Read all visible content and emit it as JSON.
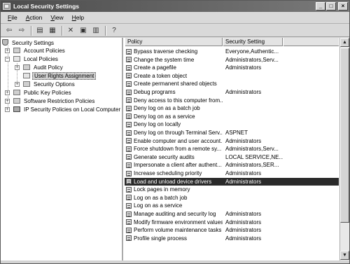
{
  "window": {
    "title": "Local Security Settings"
  },
  "menu": [
    "File",
    "Action",
    "View",
    "Help"
  ],
  "menu_mnemonic": [
    "F",
    "A",
    "V",
    "H"
  ],
  "toolbar_icons": [
    "back-arrow-icon",
    "forward-arrow-icon",
    "up-folder-icon",
    "show-hide-tree-icon",
    "delete-icon",
    "properties-icon",
    "export-list-icon",
    "help-icon"
  ],
  "tree": {
    "root": "Security Settings",
    "nodes": [
      {
        "label": "Account Policies"
      },
      {
        "label": "Local Policies"
      },
      {
        "label": "Audit Policy"
      },
      {
        "label": "User Rights Assignment"
      },
      {
        "label": "Security Options"
      },
      {
        "label": "Public Key Policies"
      },
      {
        "label": "Software Restriction Policies"
      },
      {
        "label": "IP Security Policies on Local Computer"
      }
    ]
  },
  "list": {
    "columns": [
      "Policy",
      "Security Setting"
    ],
    "rows": [
      {
        "policy": "Bypass traverse checking",
        "setting": "Everyone,Authentic..."
      },
      {
        "policy": "Change the system time",
        "setting": "Administrators,Serv..."
      },
      {
        "policy": "Create a pagefile",
        "setting": "Administrators"
      },
      {
        "policy": "Create a token object",
        "setting": ""
      },
      {
        "policy": "Create permanent shared objects",
        "setting": ""
      },
      {
        "policy": "Debug programs",
        "setting": "Administrators"
      },
      {
        "policy": "Deny access to this computer from...",
        "setting": ""
      },
      {
        "policy": "Deny log on as a batch job",
        "setting": ""
      },
      {
        "policy": "Deny log on as a service",
        "setting": ""
      },
      {
        "policy": "Deny log on locally",
        "setting": ""
      },
      {
        "policy": "Deny log on through Terminal Serv...",
        "setting": "ASPNET"
      },
      {
        "policy": "Enable computer and user account...",
        "setting": "Administrators"
      },
      {
        "policy": "Force shutdown from a remote sy...",
        "setting": "Administrators,Serv..."
      },
      {
        "policy": "Generate security audits",
        "setting": "LOCAL SERVICE,NE..."
      },
      {
        "policy": "Impersonate a client after authent...",
        "setting": "Administrators,SER..."
      },
      {
        "policy": "Increase scheduling priority",
        "setting": "Administrators"
      },
      {
        "policy": "Load and unload device drivers",
        "setting": "Administrators"
      },
      {
        "policy": "Lock pages in memory",
        "setting": ""
      },
      {
        "policy": "Log on as a batch job",
        "setting": ""
      },
      {
        "policy": "Log on as a service",
        "setting": ""
      },
      {
        "policy": "Manage auditing and security log",
        "setting": "Administrators"
      },
      {
        "policy": "Modify firmware environment values",
        "setting": "Administrators"
      },
      {
        "policy": "Perform volume maintenance tasks",
        "setting": "Administrators"
      },
      {
        "policy": "Profile single process",
        "setting": "Administrators"
      }
    ],
    "selected_index": 16
  }
}
